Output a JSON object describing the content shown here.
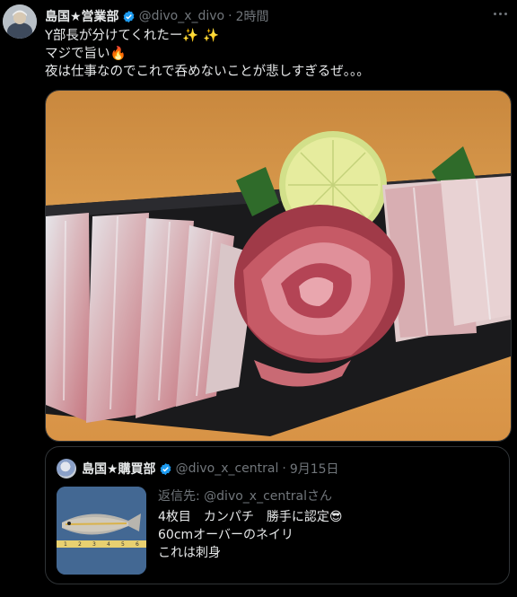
{
  "post": {
    "author_name": "島国★営業部",
    "handle": "@divo_x_divo",
    "separator": "·",
    "time": "2時間",
    "lines": [
      "Y部長が分けてくれたー",
      "マジで旨い",
      "夜は仕事なのでこれで呑めないことが悲しすぎるぜ。。。"
    ],
    "emoji": {
      "sparkles": "✨",
      "fire": "🔥"
    },
    "media_alt_icons": [
      "sashimi-plate-image"
    ]
  },
  "quote": {
    "author_name": "島国★購買部",
    "handle": "@divo_x_central",
    "separator": "·",
    "date": "9月15日",
    "reply_to": "返信先: @divo_x_centralさん",
    "lines": [
      "4枚目　カンパチ　勝手に認定",
      "60cmオーバーのネイリ",
      "これは刺身"
    ],
    "emoji": {
      "sunglasses": "😎"
    }
  },
  "colors": {
    "background": "#000000",
    "text": "#e7e9ea",
    "muted": "#71767b",
    "verified": "#1d9bf0",
    "border": "#2f3336"
  }
}
